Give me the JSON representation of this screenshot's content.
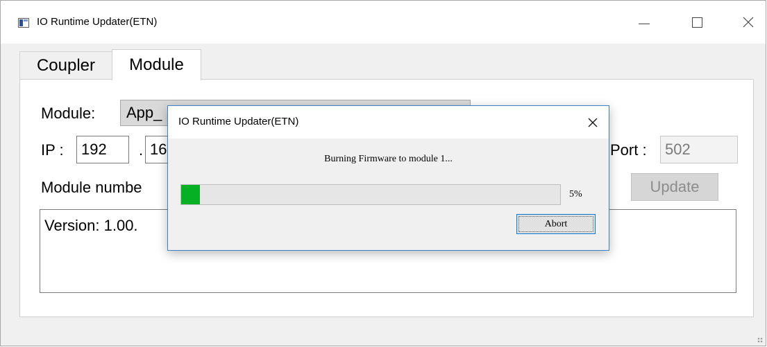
{
  "window": {
    "title": "IO Runtime Updater(ETN)",
    "minimize_icon": "minimize-icon",
    "maximize_icon": "maximize-icon",
    "close_icon": "close-icon"
  },
  "tabs": [
    {
      "label": "Coupler",
      "active": false
    },
    {
      "label": "Module",
      "active": true
    }
  ],
  "module_panel": {
    "module_label": "Module:",
    "module_value": "App_",
    "ip_label": "IP :",
    "ip_octet1": "192",
    "ip_sep1": ".",
    "ip_octet2_partial": "16",
    "port_label": "Port :",
    "port_value": "502",
    "module_number_label": "Module numbe",
    "update_label": "Update",
    "version_text": "Version: 1.00."
  },
  "dialog": {
    "title": "IO Runtime Updater(ETN)",
    "message": "Burning Firmware to module 1...",
    "progress_percent": 5,
    "progress_text": "5%",
    "abort_label": "Abort",
    "accent_color": "#06b025"
  }
}
